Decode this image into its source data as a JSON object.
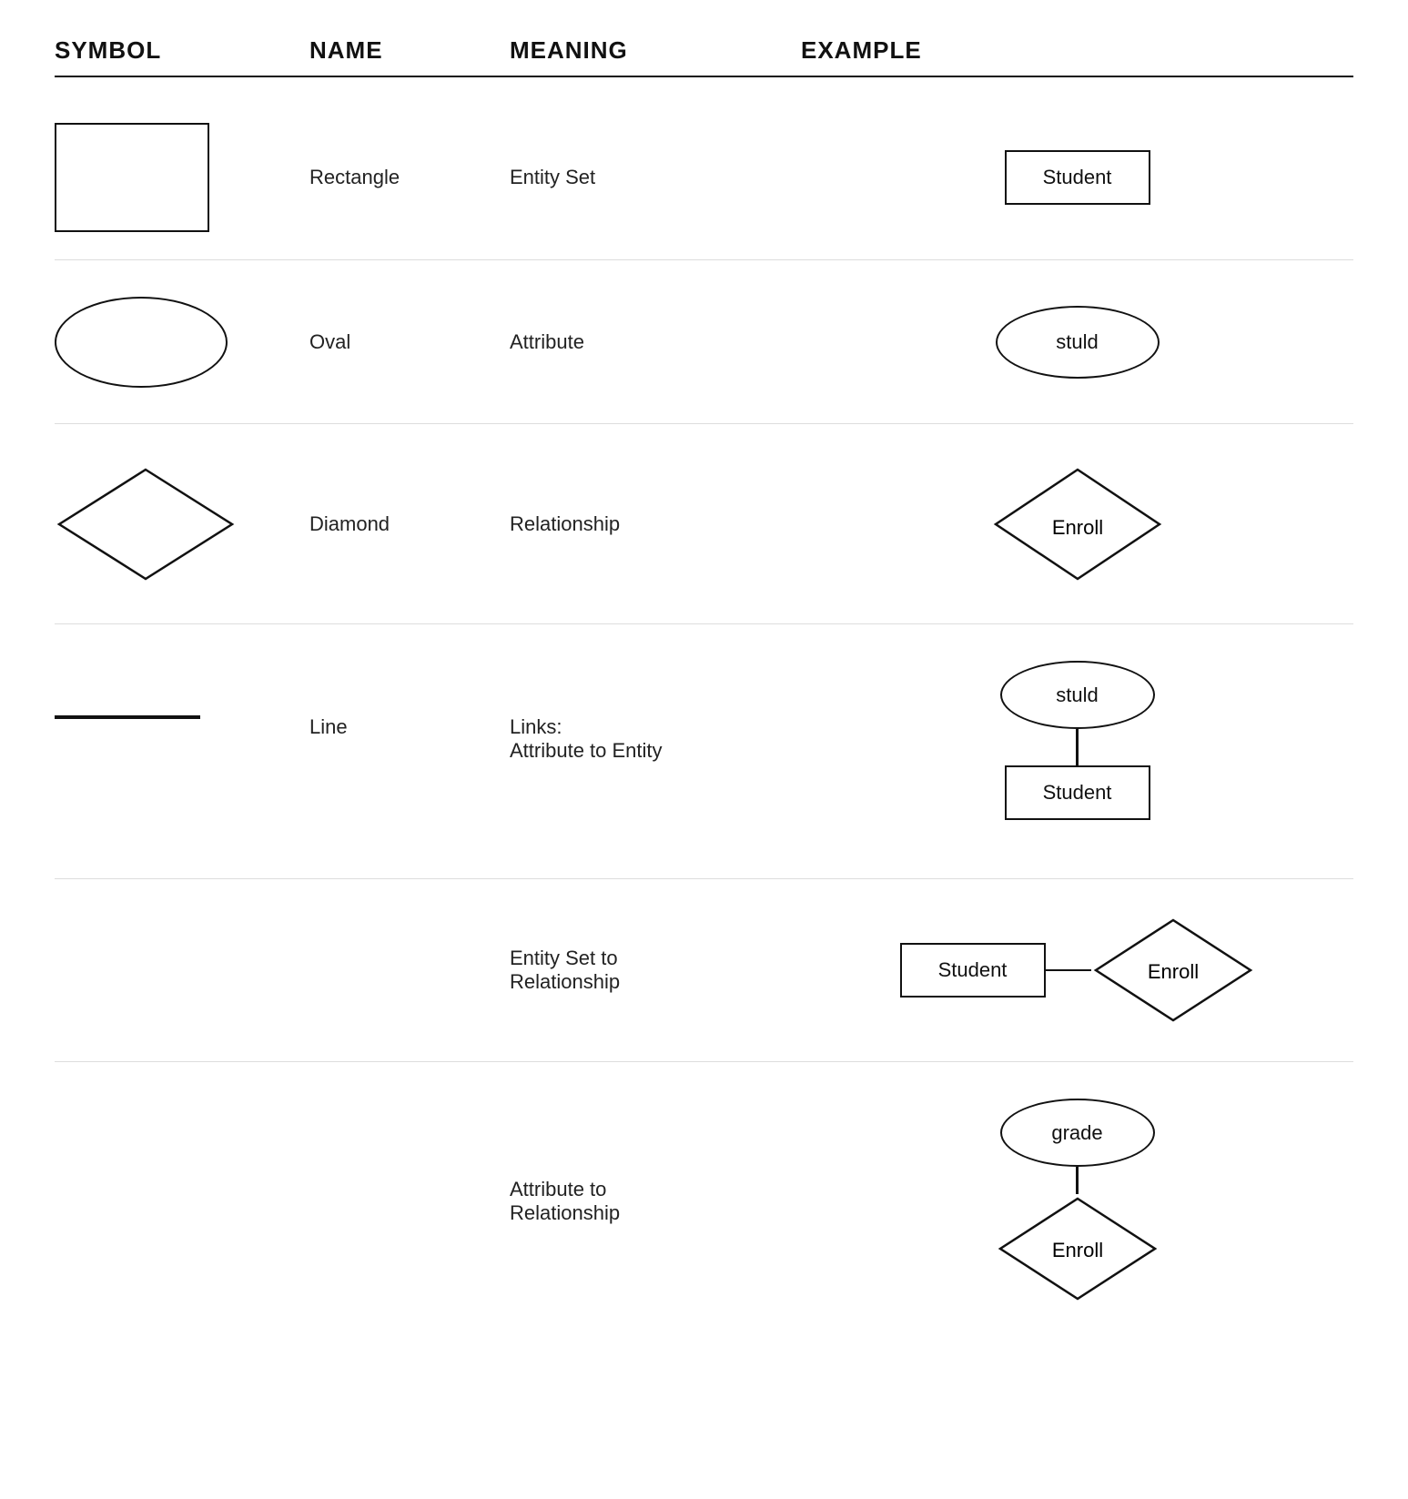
{
  "header": {
    "col1": "SYMBOL",
    "col2": "NAME",
    "col3": "MEANING",
    "col4": "EXAMPLE"
  },
  "rows": [
    {
      "id": "rectangle",
      "name": "Rectangle",
      "meaning": "Entity Set",
      "example_label": "Student"
    },
    {
      "id": "oval",
      "name": "Oval",
      "meaning": "Attribute",
      "example_label": "stuld"
    },
    {
      "id": "diamond",
      "name": "Diamond",
      "meaning": "Relationship",
      "example_label": "Enroll"
    },
    {
      "id": "line",
      "name": "Line",
      "meaning_line1": "Links:",
      "meaning_line2": "Attribute to Entity",
      "example_oval": "stuld",
      "example_rect": "Student"
    }
  ],
  "extra_rows": [
    {
      "id": "entity-set-to-relationship",
      "meaning_line1": "Entity Set to",
      "meaning_line2": "Relationship",
      "example_rect": "Student",
      "example_diamond": "Enroll"
    },
    {
      "id": "attribute-to-relationship",
      "meaning_line1": "Attribute to",
      "meaning_line2": "Relationship",
      "example_oval": "grade",
      "example_diamond": "Enroll"
    }
  ]
}
